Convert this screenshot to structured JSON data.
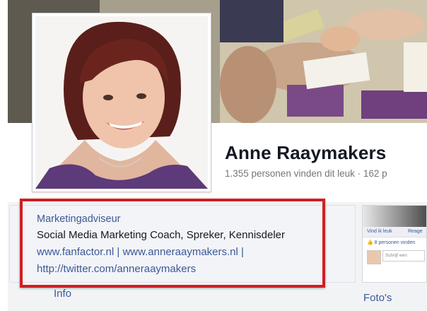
{
  "page": {
    "name": "Anne Raaymakers",
    "stats": "1.355 personen vinden dit leuk · 162 p"
  },
  "about": {
    "category": "Marketingadviseur",
    "description": "Social Media Marketing Coach, Spreker, Kennisdeler",
    "link1": "www.fanfactor.nl",
    "separator1": " | ",
    "link2": "www.anneraaymakers.nl",
    "separator2": " |",
    "link3": "http://twitter.com/anneraaymakers",
    "tab_label": "Info"
  },
  "photos_widget": {
    "like_label": "Vind ik leuk",
    "reply_label": "Reage",
    "likes_text": "8 personen vinden",
    "comment_placeholder": "Schrijf een",
    "tab_label": "Foto's"
  },
  "colors": {
    "link": "#3b5998",
    "highlight": "#d01e24",
    "text": "#141823"
  },
  "icons": [
    "thumbs-up-icon"
  ]
}
